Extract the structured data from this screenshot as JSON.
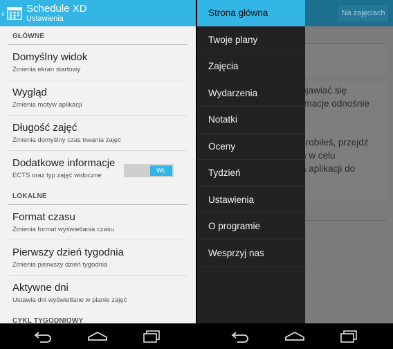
{
  "left": {
    "actionbar": {
      "back": "‹",
      "title": "Schedule XD",
      "subtitle": "Ustawienia"
    },
    "categories": {
      "main": "GŁÓWNE",
      "local": "LOKALNE",
      "weekly": "CYKL TYGODNIOWY"
    },
    "prefs": {
      "default_view": {
        "title": "Domyślny widok",
        "summary": "Zmienia ekran startowy"
      },
      "appearance": {
        "title": "Wygląd",
        "summary": "Zmienia motyw aplikacji"
      },
      "duration": {
        "title": "Długość zajęć",
        "summary": "Zmienia domyślny czas trwania zajęć"
      },
      "extra_info": {
        "title": "Dodatkowe informacje",
        "summary": "ECTS oraz typ zajęć widoczne",
        "toggle_label": "WŁ"
      },
      "time_format": {
        "title": "Format czasu",
        "summary": "Zmienia format wyświetlania czasu"
      },
      "first_day": {
        "title": "Pierwszy dzień tygodnia",
        "summary": "Zmienia pierwszy dzień tygodnia"
      },
      "active_days": {
        "title": "Aktywne dni",
        "summary": "Ustawia dni wyświetlane w planie zajęć"
      }
    }
  },
  "right": {
    "actionbar_button": "Na zajęciach",
    "drawer": {
      "items": [
        "Strona główna",
        "Twoje plany",
        "Zajęcia",
        "Wydarzenia",
        "Notatki",
        "Oceny",
        "Tydzień",
        "Ustawienia",
        "O programie",
        "Wesprzyj nas"
      ],
      "active_index": 0
    },
    "behind_text": [
      "ojawiać się",
      "rmacje odnośnie",
      "zrobiłeś, przejdź",
      "n w celu",
      "a aplikacji do"
    ]
  },
  "colors": {
    "accent": "#33b5e5",
    "drawer_bg": "#222222"
  },
  "icons": [
    "back-chevron-icon",
    "calendar-icon",
    "nav-back-icon",
    "nav-home-icon",
    "nav-recents-icon"
  ]
}
